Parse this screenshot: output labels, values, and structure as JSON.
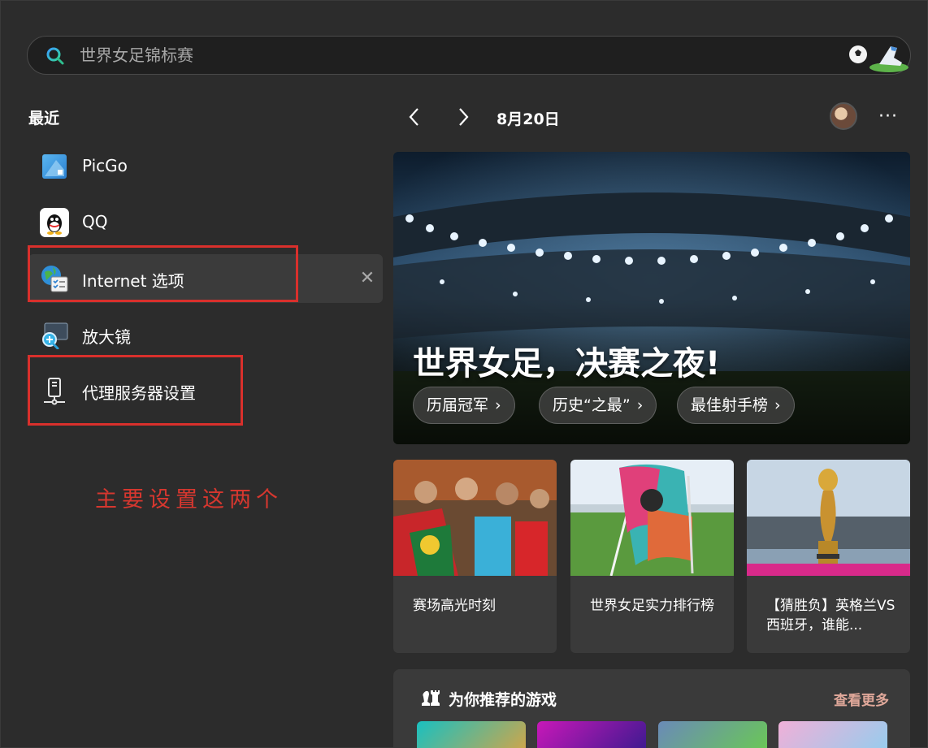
{
  "search": {
    "placeholder": "世界女足锦标赛"
  },
  "recent": {
    "title": "最近",
    "items": [
      {
        "label": "PicGo",
        "icon": "picgo-icon"
      },
      {
        "label": "QQ",
        "icon": "qq-icon"
      },
      {
        "label": "Internet 选项",
        "icon": "internet-options-icon"
      },
      {
        "label": "放大镜",
        "icon": "magnifier-icon"
      },
      {
        "label": "代理服务器设置",
        "icon": "proxy-settings-icon"
      }
    ],
    "close_glyph": "✕"
  },
  "annotation": "主要设置这两个",
  "header": {
    "date": "8月20日",
    "more_glyph": "···"
  },
  "hero": {
    "title": "世界女足，决赛之夜!",
    "pills": [
      "历届冠军",
      "历史“之最”",
      "最佳射手榜"
    ],
    "chevron": "›"
  },
  "cards": [
    {
      "text": "赛场高光时刻"
    },
    {
      "text": "世界女足实力排行榜"
    },
    {
      "text": "【猜胜负】英格兰VS西班牙，谁能..."
    }
  ],
  "games": {
    "title": "为你推荐的游戏",
    "more": "查看更多"
  },
  "colors": {
    "accent_red": "#d9302c",
    "background": "#2c2c2c",
    "card": "#3a3a3a"
  }
}
